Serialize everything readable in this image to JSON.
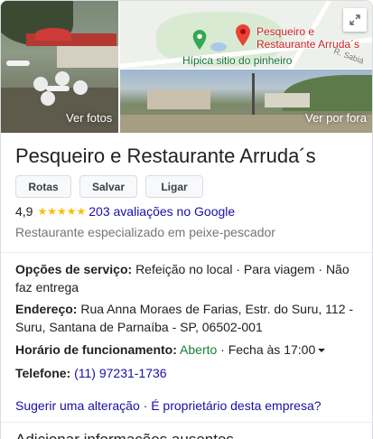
{
  "photos": {
    "left_caption": "Ver fotos",
    "right_caption": "Ver por fora"
  },
  "map": {
    "pin_label": "Pesqueiro e Restaurante Arruda´s",
    "poi_label": "Hípica sitio do pinheiro",
    "street_label": "R. Sabiá",
    "pin_color": "#ea4335",
    "poi_color": "#34a853"
  },
  "business": {
    "name": "Pesqueiro e Restaurante Arruda´s",
    "rating": "4,9",
    "stars": "★★★★★",
    "reviews_link": "203 avaliações no Google",
    "category": "Restaurante especializado em peixe-pescador"
  },
  "actions": {
    "directions": "Rotas",
    "save": "Salvar",
    "call": "Ligar"
  },
  "details": {
    "service_label": "Opções de serviço:",
    "service_value": "Refeição no local · Para viagem · Não faz entrega",
    "address_label": "Endereço:",
    "address_value": "Rua Anna Moraes de Farias, Estr. do Suru, 112 - Suru, Santana de Parnaíba - SP, 06502-001",
    "hours_label": "Horário de funcionamento:",
    "hours_status": "Aberto",
    "hours_close": " · Fecha às 17:00",
    "phone_label": "Telefone:",
    "phone_value": "(11) 97231-1736"
  },
  "footer": {
    "suggest_edit": "Sugerir uma alteração",
    "separator": " · ",
    "own_business": "É proprietário desta empresa?",
    "add_info": "Adicionar informações ausentes"
  }
}
